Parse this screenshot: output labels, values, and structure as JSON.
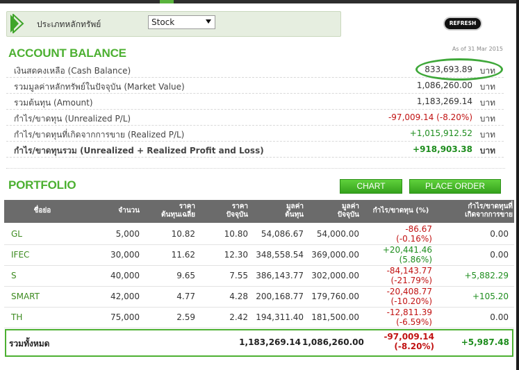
{
  "filter": {
    "label": "ประเภทหลักทรัพย์",
    "selected": "Stock",
    "refresh_label": "REFRESH"
  },
  "balance": {
    "title": "ACCOUNT BALANCE",
    "as_of": "As of 31 Mar 2015",
    "rows": [
      {
        "label": "เงินสดคงเหลือ (Cash Balance)",
        "value": "833,693.89",
        "unit": "บาท"
      },
      {
        "label": "รวมมูลค่าหลักทรัพย์ในปัจจุบัน (Market Value)",
        "value": "1,086,260.00",
        "unit": "บาท"
      },
      {
        "label": "รวมต้นทุน (Amount)",
        "value": "1,183,269.14",
        "unit": "บาท"
      },
      {
        "label": "กำไร/ขาดทุน (Unrealized P/L)",
        "value": "-97,009.14 (-8.20%)",
        "unit": "บาท"
      },
      {
        "label": "กำไร/ขาดทุนที่เกิดจากการขาย (Realized P/L)",
        "value": "+1,015,912.52",
        "unit": "บาท"
      },
      {
        "label": "กำไร/ขาดทุนรวม (Unrealized + Realized Profit and Loss)",
        "value": "+918,903.38",
        "unit": "บาท"
      }
    ]
  },
  "portfolio": {
    "title": "PORTFOLIO",
    "chart_label": "CHART",
    "order_label": "PLACE ORDER",
    "headers": {
      "symbol": "ชื่อย่อ",
      "volume": "จำนวน",
      "avg_cost_1": "ราคา",
      "avg_cost_2": "ต้นทุนเฉลี่ย",
      "price_1": "ราคา",
      "price_2": "ปัจจุบัน",
      "amount_1": "มูลค่า",
      "amount_2": "ต้นทุน",
      "market_1": "มูลค่า",
      "market_2": "ปัจจุบัน",
      "unreal": "กำไร/ขาดทุน (%)",
      "real_1": "กำไร/ขาดทุนที่",
      "real_2": "เกิดจากการขาย"
    },
    "rows": [
      {
        "symbol": "GL",
        "volume": "5,000",
        "avg": "10.82",
        "price": "10.80",
        "amount": "54,086.67",
        "market": "54,000.00",
        "pl": "-86.67",
        "pct": "(-0.16%)",
        "realized": "0.00"
      },
      {
        "symbol": "IFEC",
        "volume": "30,000",
        "avg": "11.62",
        "price": "12.30",
        "amount": "348,558.54",
        "market": "369,000.00",
        "pl": "+20,441.46",
        "pct": "(5.86%)",
        "realized": "0.00"
      },
      {
        "symbol": "S",
        "volume": "40,000",
        "avg": "9.65",
        "price": "7.55",
        "amount": "386,143.77",
        "market": "302,000.00",
        "pl": "-84,143.77",
        "pct": "(-21.79%)",
        "realized": "+5,882.29"
      },
      {
        "symbol": "SMART",
        "volume": "42,000",
        "avg": "4.77",
        "price": "4.28",
        "amount": "200,168.77",
        "market": "179,760.00",
        "pl": "-20,408.77",
        "pct": "(-10.20%)",
        "realized": "+105.20"
      },
      {
        "symbol": "TH",
        "volume": "75,000",
        "avg": "2.59",
        "price": "2.42",
        "amount": "194,311.40",
        "market": "181,500.00",
        "pl": "-12,811.39",
        "pct": "(-6.59%)",
        "realized": "0.00"
      }
    ],
    "total": {
      "label": "รวมทั้งหมด",
      "amount": "1,183,269.14",
      "market": "1,086,260.00",
      "pl": "-97,009.14",
      "pct": "(-8.20%)",
      "realized": "+5,987.48"
    }
  },
  "colors": {
    "accent_green": "#4cb031",
    "negative_red": "#c11212",
    "positive_green": "#1e8d1e",
    "header_gray": "#6b6b6b"
  }
}
